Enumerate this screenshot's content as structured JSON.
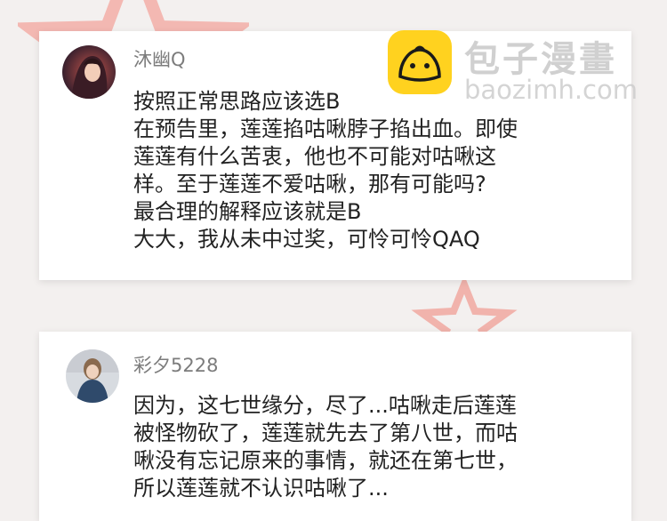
{
  "watermark": {
    "title": "包子漫畫",
    "url": "baozimh.com"
  },
  "comments": [
    {
      "username": "沐幽Q",
      "lines": [
        "按照正常思路应该选B",
        "在预告里，莲莲掐咕啾脖子掐出血。即使",
        "莲莲有什么苦衷，他也不可能对咕啾这",
        "样。至于莲莲不爱咕啾，那有可能吗?",
        "最合理的解释应该就是B",
        "大大，我从未中过奖，可怜可怜QAQ"
      ]
    },
    {
      "username": "彩夕5228",
      "lines": [
        "因为，这七世缘分，尽了...咕啾走后莲莲",
        "被怪物砍了，莲莲就先去了第八世，而咕",
        "啾没有忘记原来的事情，就还在第七世，",
        "所以莲莲就不认识咕啾了..."
      ]
    }
  ],
  "colors": {
    "background": "#f3f0ef",
    "star": "#f3b8b2",
    "logo": "#ffd21f"
  }
}
